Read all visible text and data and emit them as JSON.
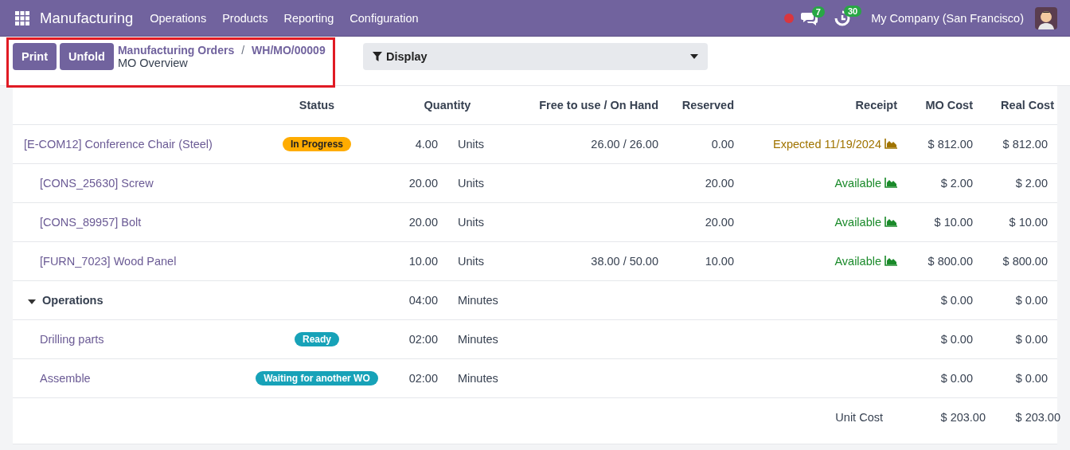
{
  "navbar": {
    "app_name": "Manufacturing",
    "menus": [
      "Operations",
      "Products",
      "Reporting",
      "Configuration"
    ],
    "messages_count": "7",
    "activities_count": "30",
    "company": "My Company (San Francisco)"
  },
  "control_panel": {
    "highlighted": true,
    "buttons": [
      "Print",
      "Unfold"
    ],
    "breadcrumbs": [
      "Manufacturing Orders",
      "WH/MO/00009"
    ],
    "breadcrumb_separator": "/",
    "title": "MO Overview",
    "display": "Display"
  },
  "table": {
    "columns": [
      "Status",
      "Quantity",
      "Free to use / On Hand",
      "Reserved",
      "Receipt",
      "MO Cost",
      "Real Cost"
    ],
    "rows": [
      {
        "kind": "line",
        "name": "[E-COM12] Conference Chair (Steel)",
        "status": {
          "label": "In Progress",
          "color": "#ffac00"
        },
        "quantity": "4.00",
        "unit": "Units",
        "free_on_hand": "26.00 / 26.00",
        "reserved": "0.00",
        "receipt": {
          "label": "Expected 11/19/2024",
          "color": "#a07400"
        },
        "mo_cost": "$ 812.00",
        "real_cost": "$ 812.00",
        "children": [
          {
            "kind": "line",
            "name": "[CONS_25630] Screw",
            "quantity": "20.00",
            "unit": "Units",
            "reserved": "20.00",
            "receipt": {
              "label": "Available",
              "color": "#1a8a2a"
            },
            "mo_cost": "$ 2.00",
            "real_cost": "$ 2.00"
          },
          {
            "kind": "line",
            "name": "[CONS_89957] Bolt",
            "quantity": "20.00",
            "unit": "Units",
            "reserved": "20.00",
            "receipt": {
              "label": "Available",
              "color": "#1a8a2a"
            },
            "mo_cost": "$ 10.00",
            "real_cost": "$ 10.00"
          },
          {
            "kind": "line",
            "name": "[FURN_7023] Wood Panel",
            "quantity": "10.00",
            "unit": "Units",
            "free_on_hand": "38.00 / 50.00",
            "reserved": "10.00",
            "receipt": {
              "label": "Available",
              "color": "#1a8a2a"
            },
            "mo_cost": "$ 800.00",
            "real_cost": "$ 800.00"
          }
        ]
      },
      {
        "kind": "group",
        "name": "Operations",
        "expanded": true,
        "quantity": "04:00",
        "unit": "Minutes",
        "mo_cost": "$ 0.00",
        "real_cost": "$ 0.00",
        "children": [
          {
            "kind": "line",
            "name": "Drilling parts",
            "status": {
              "label": "Ready",
              "color": "#17a2b8"
            },
            "quantity": "02:00",
            "unit": "Minutes",
            "mo_cost": "$ 0.00",
            "real_cost": "$ 0.00"
          },
          {
            "kind": "line",
            "name": "Assemble",
            "status": {
              "label": "Waiting for another WO",
              "color": "#17a2b8"
            },
            "quantity": "02:00",
            "unit": "Minutes",
            "mo_cost": "$ 0.00",
            "real_cost": "$ 0.00"
          }
        ]
      }
    ],
    "total": {
      "label": "Unit Cost",
      "mo_cost": "$ 203.00",
      "real_cost": "$ 203.00"
    }
  }
}
